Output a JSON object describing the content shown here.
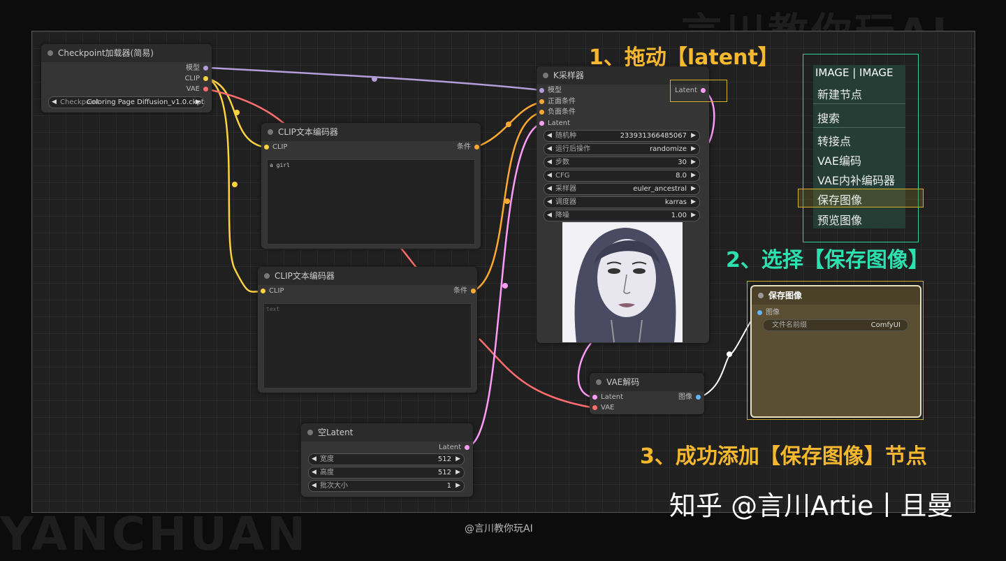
{
  "watermark": {
    "top": "言川教你玩AI",
    "bottom": "YANCHUAN"
  },
  "nodes": {
    "checkpoint": {
      "title": "Checkpoint加载器(简易)",
      "outputs": [
        "模型",
        "CLIP",
        "VAE"
      ],
      "ckpt_label": "Checkpoint",
      "ckpt_value": "Coloring Page Diffusion_v1.0.ckpt"
    },
    "clip1": {
      "title": "CLIP文本编码器",
      "input": "CLIP",
      "output": "条件",
      "text": "a girl"
    },
    "clip2": {
      "title": "CLIP文本编码器",
      "input": "CLIP",
      "output": "条件",
      "placeholder": "text"
    },
    "ksampler": {
      "title": "K采样器",
      "inputs": [
        "模型",
        "正面条件",
        "负面条件",
        "Latent"
      ],
      "output": "Latent",
      "widgets": [
        {
          "label": "随机种",
          "value": "233931366485067"
        },
        {
          "label": "运行后操作",
          "value": "randomize"
        },
        {
          "label": "步数",
          "value": "30"
        },
        {
          "label": "CFG",
          "value": "8.0"
        },
        {
          "label": "采样器",
          "value": "euler_ancestral"
        },
        {
          "label": "调度器",
          "value": "karras"
        },
        {
          "label": "降噪",
          "value": "1.00"
        }
      ]
    },
    "empty_latent": {
      "title": "空Latent",
      "output": "Latent",
      "widgets": [
        {
          "label": "宽度",
          "value": "512"
        },
        {
          "label": "高度",
          "value": "512"
        },
        {
          "label": "批次大小",
          "value": "1"
        }
      ]
    },
    "vae_decode": {
      "title": "VAE解码",
      "inputs": [
        "Latent",
        "VAE"
      ],
      "output": "图像"
    },
    "save_image": {
      "title": "保存图像",
      "input": "图像",
      "widget_label": "文件名前缀",
      "widget_value": "ComfyUI"
    }
  },
  "context_menu": {
    "title": "IMAGE | IMAGE",
    "items": [
      "新建节点",
      "搜索",
      "转接点",
      "VAE编码",
      "VAE内补编码器",
      "保存图像",
      "预览图像"
    ],
    "selected": "保存图像"
  },
  "annotations": {
    "step1": "1、拖动【latent】",
    "step2": "2、选择【保存图像】",
    "step3": "3、成功添加【保存图像】节点"
  },
  "footer": {
    "zhihu": "知乎 @言川Artie丨且曼",
    "credit": "@言川教你玩AI"
  },
  "colors": {
    "model": "#b39ddb",
    "clip": "#ffd23f",
    "vae": "#ff6e6e",
    "cond": "#ffa931",
    "latent": "#ff9cf9",
    "image": "#64b5f6",
    "anno_yellow": "#f5b82e",
    "anno_green": "#2de0b0"
  }
}
